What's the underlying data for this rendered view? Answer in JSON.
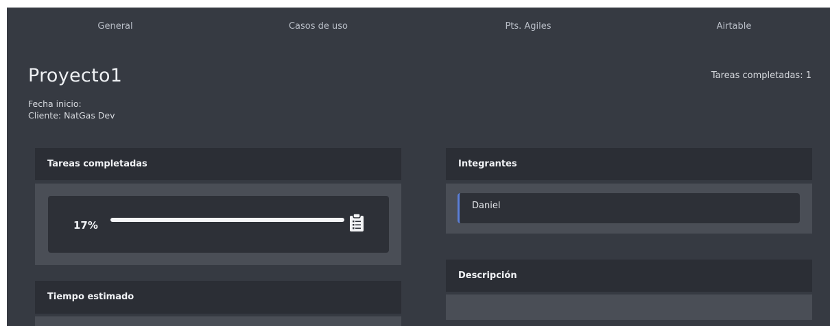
{
  "nav": {
    "tabs": [
      {
        "label": "General"
      },
      {
        "label": "Casos de uso"
      },
      {
        "label": "Pts. Agiles"
      },
      {
        "label": "Airtable"
      }
    ]
  },
  "project": {
    "title": "Proyecto1",
    "tasks_completed_text": "Tareas completadas: 1",
    "start_date_text": "Fecha inicio:",
    "client_text": "Cliente: NatGas Dev"
  },
  "cards": {
    "tasks": {
      "title": "Tareas completadas",
      "progress_text": "17%",
      "progress_fraction": 1.0,
      "icon": "clipboard-list-icon"
    },
    "time": {
      "title": "Tiempo estimado"
    },
    "members": {
      "title": "Integrantes",
      "items": [
        {
          "name": "Daniel"
        }
      ],
      "accent_color": "#5b7fd8"
    },
    "description": {
      "title": "Descripción"
    }
  },
  "colors": {
    "page_background": "#363a42",
    "card_header": "#2b2e35",
    "card_body": "#4a4e56",
    "inner_box": "#2d3037"
  }
}
